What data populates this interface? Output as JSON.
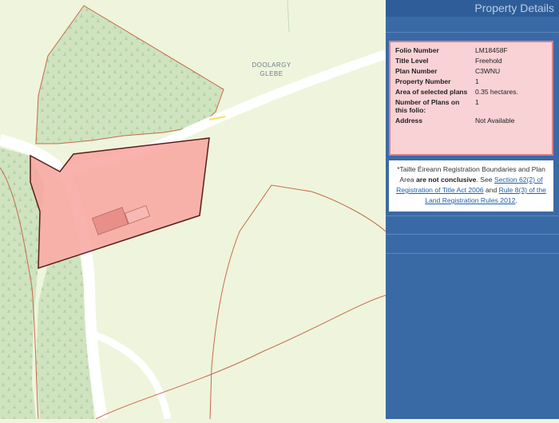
{
  "map": {
    "place_label_line1": "DOOLARGY",
    "place_label_line2": "GLEBE",
    "colors": {
      "background": "#eef5dc",
      "woodland": "#cfe3c0",
      "road": "#ffffff",
      "boundary": "#c8694e",
      "selected_parcel_fill": "#f8a5a0",
      "selected_parcel_outline": "#5b1d1d"
    }
  },
  "panel": {
    "title": "Property Details",
    "details": [
      {
        "label": "Folio Number",
        "value": "LM18458F"
      },
      {
        "label": "Title Level",
        "value": "Freehold"
      },
      {
        "label": "Plan Number",
        "value": "C3WNU"
      },
      {
        "label": "Property Number",
        "value": "1"
      },
      {
        "label": "Area of selected plans",
        "value": "0.35 hectares."
      },
      {
        "label": "Number of Plans on this folio:",
        "value": "1"
      },
      {
        "label": "Address",
        "value": "Not Available"
      }
    ],
    "disclaimer": {
      "intro": "*Tailte Éireann Registration Boundaries and Plan Area",
      "emphasis": "are not conclusive",
      "see": ". See",
      "link1": "Section 62(2) of Registration of Title Act 2006",
      "and": "and",
      "link2": "Rule 8(3) of the Land Registration Rules 2012",
      "end": "."
    }
  }
}
